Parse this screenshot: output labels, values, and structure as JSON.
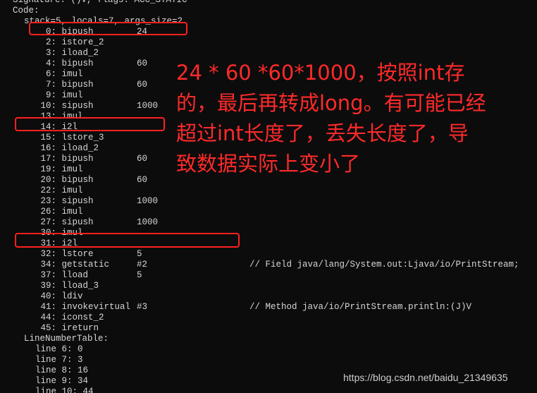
{
  "console": {
    "lines": [
      {
        "indent": 0,
        "cols": [
          "Signature: ()V, flags: ACC_STATIC"
        ]
      },
      {
        "indent": 0,
        "cols": [
          "Code:"
        ]
      },
      {
        "indent": 1,
        "cols": [
          "stack=5, locals=7, args_size=2"
        ]
      },
      {
        "indent": 2,
        "cols": [
          "  0: bipush",
          "24"
        ]
      },
      {
        "indent": 2,
        "cols": [
          "  2: istore_2"
        ]
      },
      {
        "indent": 2,
        "cols": [
          "  3: iload_2"
        ]
      },
      {
        "indent": 2,
        "cols": [
          "  4: bipush",
          "60"
        ]
      },
      {
        "indent": 2,
        "cols": [
          "  6: imul"
        ]
      },
      {
        "indent": 2,
        "cols": [
          "  7: bipush",
          "60"
        ]
      },
      {
        "indent": 2,
        "cols": [
          "  9: imul"
        ]
      },
      {
        "indent": 2,
        "cols": [
          " 10: sipush",
          "1000"
        ]
      },
      {
        "indent": 2,
        "cols": [
          " 13: imul"
        ]
      },
      {
        "indent": 2,
        "cols": [
          " 14: i2l"
        ]
      },
      {
        "indent": 2,
        "cols": [
          " 15: lstore_3"
        ]
      },
      {
        "indent": 2,
        "cols": [
          " 16: iload_2"
        ]
      },
      {
        "indent": 2,
        "cols": [
          " 17: bipush",
          "60"
        ]
      },
      {
        "indent": 2,
        "cols": [
          " 19: imul"
        ]
      },
      {
        "indent": 2,
        "cols": [
          " 20: bipush",
          "60"
        ]
      },
      {
        "indent": 2,
        "cols": [
          " 22: imul"
        ]
      },
      {
        "indent": 2,
        "cols": [
          " 23: sipush",
          "1000"
        ]
      },
      {
        "indent": 2,
        "cols": [
          " 26: imul"
        ]
      },
      {
        "indent": 2,
        "cols": [
          " 27: sipush",
          "1000"
        ]
      },
      {
        "indent": 2,
        "cols": [
          " 30: imul"
        ]
      },
      {
        "indent": 2,
        "cols": [
          " 31: i2l"
        ]
      },
      {
        "indent": 2,
        "cols": [
          " 32: lstore",
          "5"
        ]
      },
      {
        "indent": 2,
        "cols": [
          " 34: getstatic",
          "#2",
          "// Field java/lang/System.out:Ljava/io/PrintStream;"
        ]
      },
      {
        "indent": 2,
        "cols": [
          " 37: lload",
          "5"
        ]
      },
      {
        "indent": 2,
        "cols": [
          " 39: lload_3"
        ]
      },
      {
        "indent": 2,
        "cols": [
          " 40: ldiv"
        ]
      },
      {
        "indent": 2,
        "cols": [
          " 41: invokevirtual",
          "#3",
          "// Method java/io/PrintStream.println:(J)V"
        ]
      },
      {
        "indent": 2,
        "cols": [
          " 44: iconst_2"
        ]
      },
      {
        "indent": 2,
        "cols": [
          " 45: ireturn"
        ]
      },
      {
        "indent": 1,
        "cols": [
          "LineNumberTable:"
        ]
      },
      {
        "indent": 2,
        "cols": [
          "line 6: 0"
        ]
      },
      {
        "indent": 2,
        "cols": [
          "line 7: 3"
        ]
      },
      {
        "indent": 2,
        "cols": [
          "line 8: 16"
        ]
      },
      {
        "indent": 2,
        "cols": [
          "line 9: 34"
        ]
      },
      {
        "indent": 2,
        "cols": [
          "line 10: 44"
        ]
      }
    ]
  },
  "annotation": {
    "color": "#ff2a2a",
    "lines": [
      "24 * 60 *60*1000，按照int存",
      "的，最后再转成long。有可能已经",
      "超过int长度了，丢失长度了，导",
      "致数据实际上变小了"
    ]
  },
  "highlights": [
    {
      "target": "0: bipush 24"
    },
    {
      "target": "14: i2l"
    },
    {
      "target": "31: i2l"
    }
  ],
  "watermark": {
    "text": "https://blog.csdn.net/baidu_21349635"
  }
}
